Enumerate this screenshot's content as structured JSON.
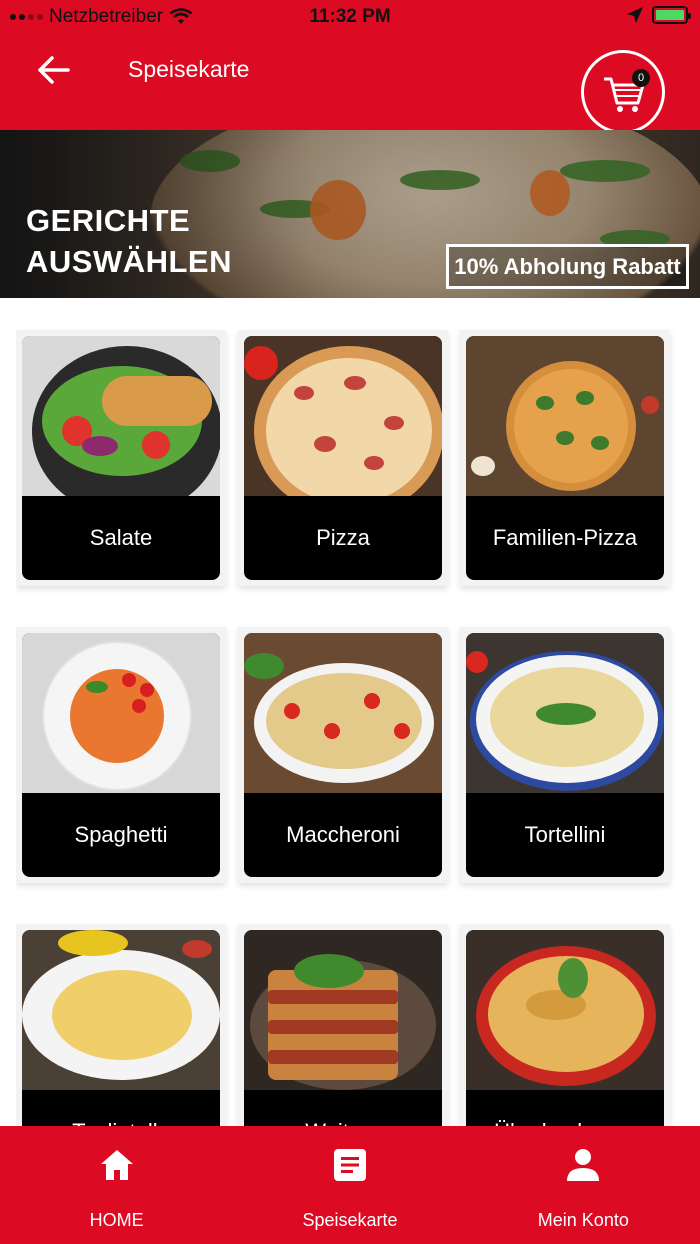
{
  "status_bar": {
    "carrier": "Netzbetreiber",
    "time": "11:32 PM"
  },
  "header": {
    "title": "Speisekarte",
    "cart_count": "0",
    "back_icon": "arrow-left-icon",
    "cart_icon": "shopping-cart-icon"
  },
  "banner": {
    "title_line1": "GERICHTE",
    "title_line2": "AUSWÄHLEN",
    "discount": "10% Abholung Rabatt"
  },
  "categories": [
    {
      "label": "Salate",
      "image": "salad-image"
    },
    {
      "label": "Pizza",
      "image": "pizza-image"
    },
    {
      "label": "Familien-Pizza",
      "image": "family-pizza-image"
    },
    {
      "label": "Spaghetti",
      "image": "spaghetti-image"
    },
    {
      "label": "Maccheroni",
      "image": "maccheroni-image"
    },
    {
      "label": "Tortellini",
      "image": "tortellini-image"
    },
    {
      "label": "Tagliatelle",
      "image": "tagliatelle-image"
    },
    {
      "label": "Weitere",
      "image": "lasagna-image"
    },
    {
      "label": "Überbackenes",
      "image": "gratin-image"
    }
  ],
  "tabbar": {
    "items": [
      {
        "label": "HOME",
        "icon": "home-icon"
      },
      {
        "label": "Speisekarte",
        "icon": "menu-document-icon"
      },
      {
        "label": "Mein Konto",
        "icon": "user-icon"
      }
    ]
  },
  "colors": {
    "brand_red": "#dc0a23",
    "card_label_bg": "#000000",
    "text_light": "#ffffff"
  }
}
